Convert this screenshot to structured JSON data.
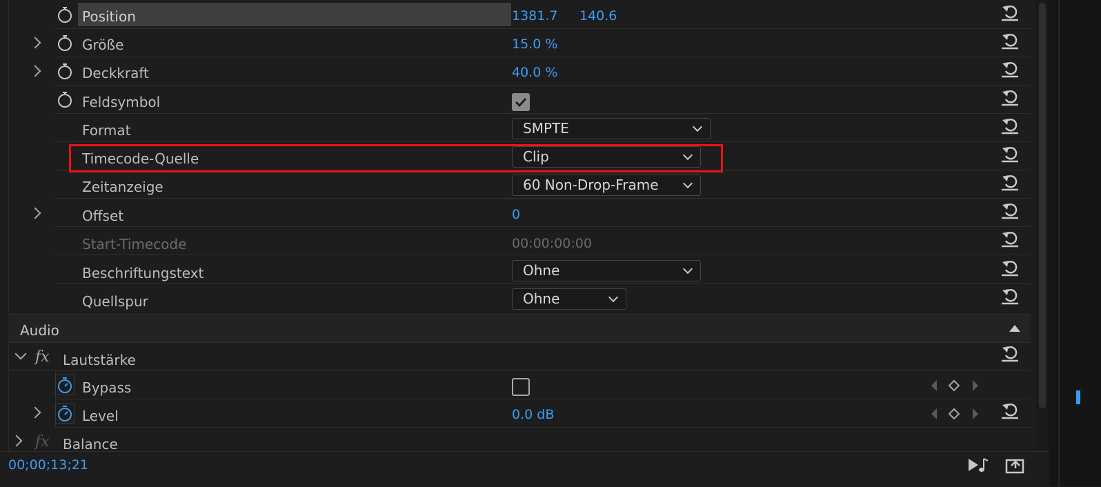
{
  "rows": [
    {
      "label": "Position",
      "values": [
        "1381.7",
        "140.6"
      ]
    },
    {
      "label": "Größe",
      "value": "15.0 %"
    },
    {
      "label": "Deckkraft",
      "value": "40.0 %"
    },
    {
      "label": "Feldsymbol",
      "checked": true
    },
    {
      "label": "Format",
      "select": "SMPTE"
    },
    {
      "label": "Timecode-Quelle",
      "select": "Clip"
    },
    {
      "label": "Zeitanzeige",
      "select": "60 Non-Drop-Frame"
    },
    {
      "label": "Offset",
      "value": "0"
    },
    {
      "label": "Start-Timecode",
      "value": "00:00:00:00"
    },
    {
      "label": "Beschriftungstext",
      "select": "Ohne"
    },
    {
      "label": "Quellspur",
      "select": "Ohne"
    }
  ],
  "audio": {
    "section": "Audio",
    "effect": "Lautstärke",
    "bypass": {
      "label": "Bypass",
      "checked": false
    },
    "level": {
      "label": "Level",
      "value": "0.0 dB"
    },
    "balance": "Balance"
  },
  "footer": {
    "timecode": "00;00;13;21"
  },
  "colors": {
    "accent": "#3b9cf5",
    "highlight": "#e8141a",
    "background": "#1d1d1d"
  }
}
